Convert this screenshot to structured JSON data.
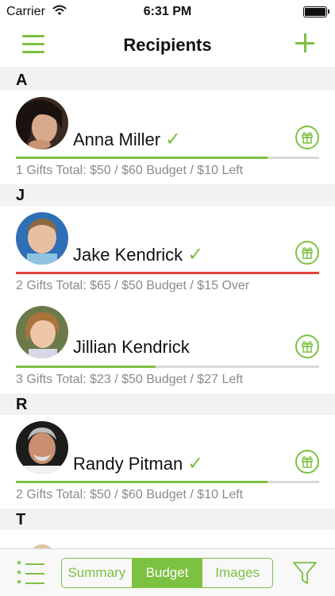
{
  "status_bar": {
    "carrier": "Carrier",
    "time": "6:31 PM"
  },
  "nav": {
    "title": "Recipients",
    "menu_icon": "hamburger-menu-icon",
    "add_icon": "plus-icon"
  },
  "accent_color": "#7cc142",
  "over_budget_color": "#e8413f",
  "sections": [
    {
      "letter": "A",
      "recipients": [
        {
          "name": "Anna Miller",
          "checked": true,
          "progress": 0.83,
          "over": false,
          "summary": "1 Gifts Total: $50 / $60 Budget / $10 Left"
        }
      ]
    },
    {
      "letter": "J",
      "recipients": [
        {
          "name": "Jake Kendrick",
          "checked": true,
          "progress": 1.0,
          "over": true,
          "summary": "2 Gifts Total: $65 / $50 Budget / $15 Over"
        },
        {
          "name": "Jillian Kendrick",
          "checked": false,
          "progress": 0.46,
          "over": false,
          "summary": "3 Gifts Total: $23 / $50 Budget / $27 Left"
        }
      ]
    },
    {
      "letter": "R",
      "recipients": [
        {
          "name": "Randy Pitman",
          "checked": true,
          "progress": 0.83,
          "over": false,
          "summary": "2 Gifts Total: $50 / $60 Budget / $10 Left"
        }
      ]
    },
    {
      "letter": "T",
      "recipients": []
    }
  ],
  "tab_bar": {
    "segments": [
      "Summary",
      "Budget",
      "Images"
    ],
    "selected": "Budget",
    "left_icon": "starred-list-icon",
    "right_icon": "filter-icon"
  }
}
